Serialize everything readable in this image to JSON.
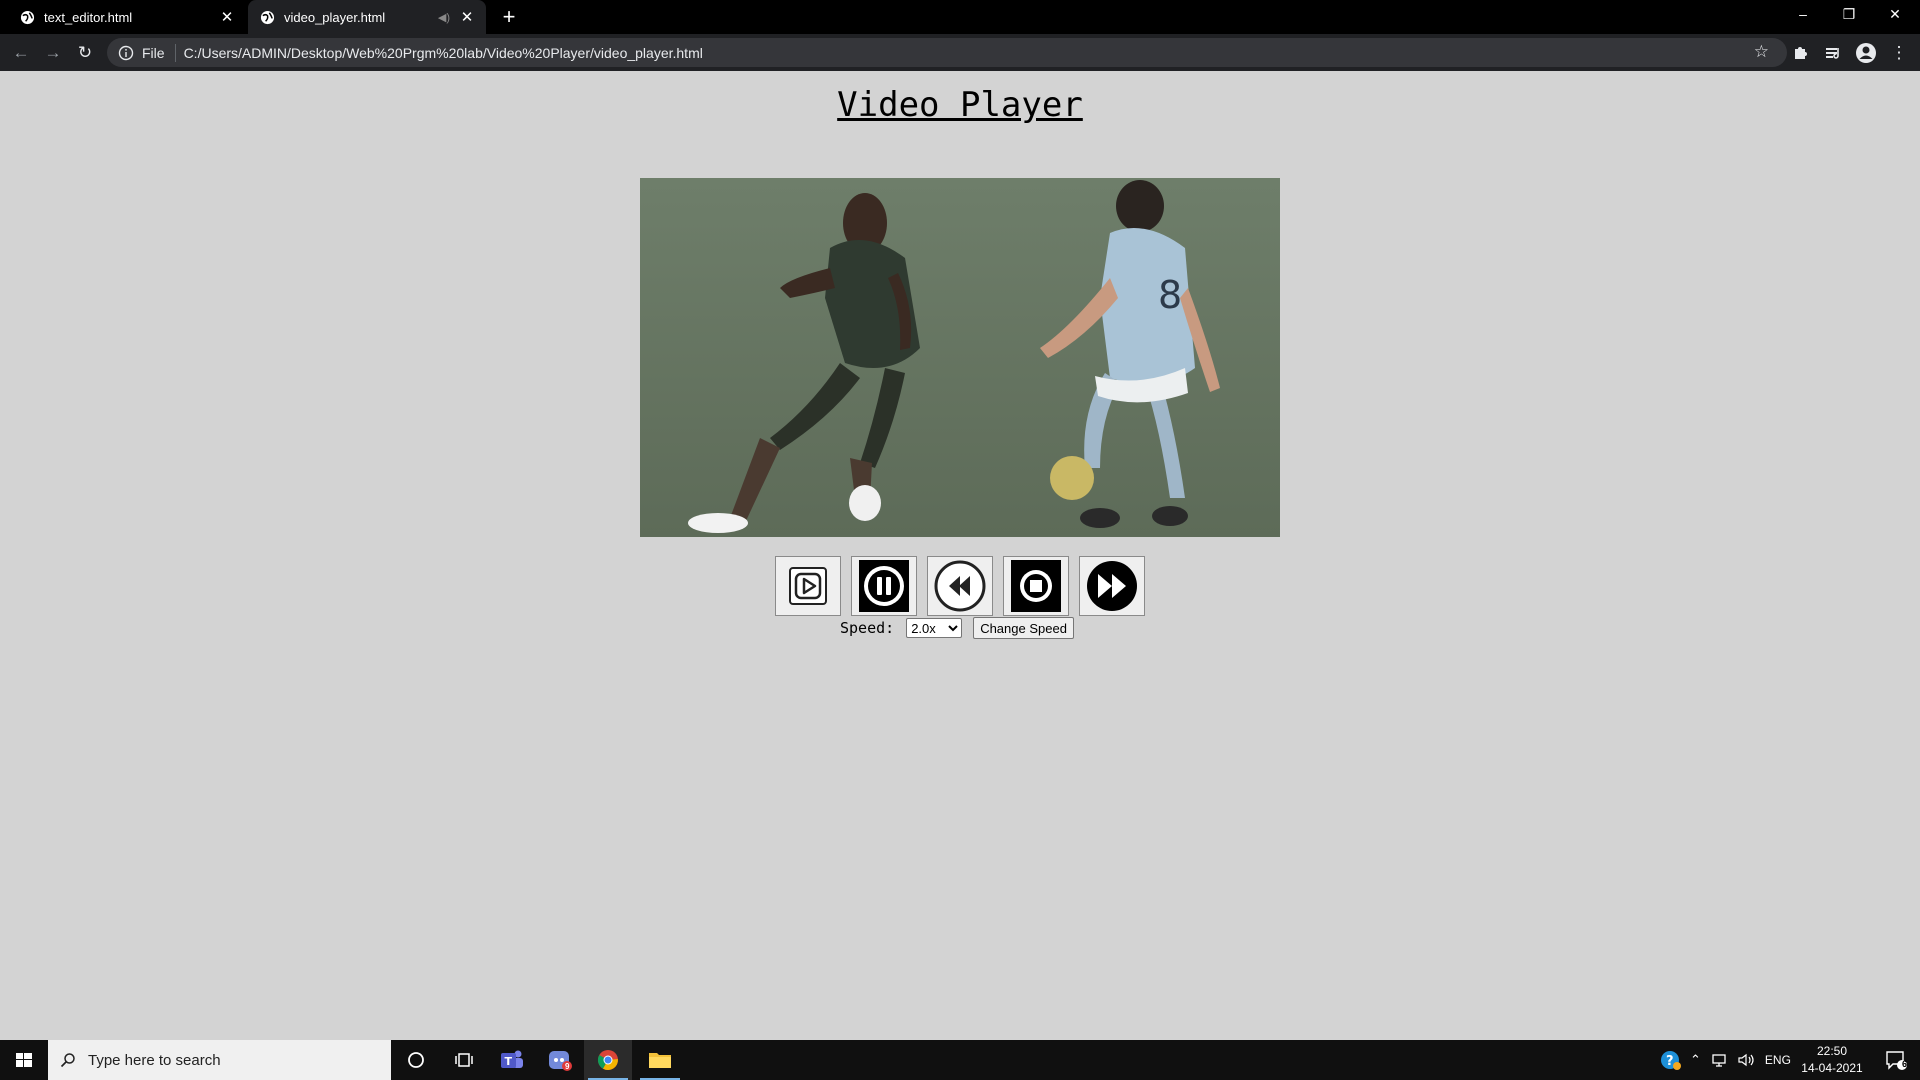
{
  "browser": {
    "tabs": [
      {
        "label": "text_editor.html",
        "active": false
      },
      {
        "label": "video_player.html",
        "active": true
      }
    ],
    "address": {
      "scheme_label": "File",
      "url": "C:/Users/ADMIN/Desktop/Web%20Prgm%20lab/Video%20Player/video_player.html"
    }
  },
  "page": {
    "title": "Video Player",
    "controls": [
      {
        "name": "play",
        "icon": "play-icon"
      },
      {
        "name": "pause",
        "icon": "pause-icon"
      },
      {
        "name": "rewind",
        "icon": "rewind-icon"
      },
      {
        "name": "stop",
        "icon": "stop-icon"
      },
      {
        "name": "fast-forward",
        "icon": "fast-forward-icon"
      }
    ],
    "speed": {
      "label": "Speed:",
      "selected": "2.0x",
      "button_label": "Change Speed"
    }
  },
  "taskbar": {
    "search_placeholder": "Type here to search",
    "language": "ENG",
    "time": "22:50",
    "date": "14-04-2021",
    "notification_count": "6",
    "discord_badge": "9"
  },
  "colors": {
    "page_background": "#d3d3d3",
    "browser_frame": "#000000",
    "toolbar": "#202124"
  }
}
